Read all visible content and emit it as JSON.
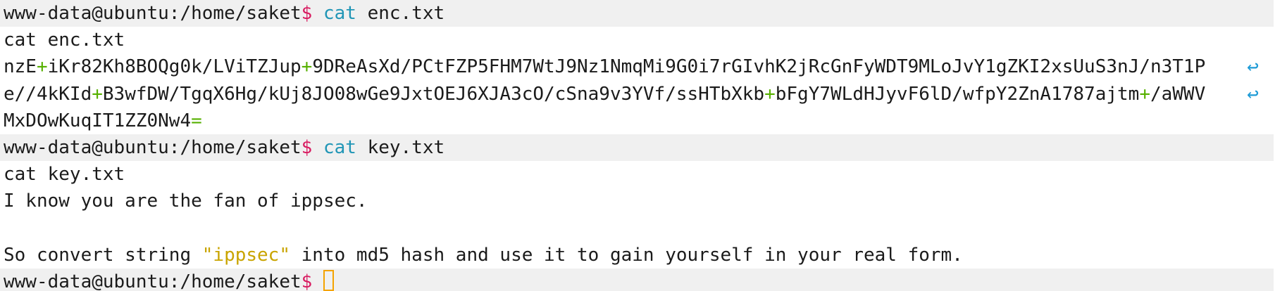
{
  "terminal": {
    "lines": [
      {
        "type": "prompt",
        "user_host_path": "www-data@ubuntu:/home/saket",
        "sign": "$",
        "command": "cat",
        "args": " enc.txt"
      },
      {
        "type": "output",
        "text": "cat enc.txt"
      },
      {
        "type": "encoded",
        "segments": [
          "nzE",
          "+",
          "iKr82Kh8BOQg0k/LViTZJup",
          "+",
          "9DReAsXd/PCtFZP5FHM7WtJ9Nz1NmqMi9G0i7rGIvhK2jRcGnFyWDT9MLoJvY1gZKI2xsUuS3nJ/n3T1P"
        ],
        "wrap_icon": "wrap-arrow-icon"
      },
      {
        "type": "encoded",
        "segments": [
          "e//4kKId",
          "+",
          "B3wfDW/TgqX6Hg/kUj8JO08wGe9JxtOEJ6XJA3cO/cSna9v3YVf/ssHTbXkb",
          "+",
          "bFgY7WLdHJyvF6lD/wfpY2ZnA1787ajtm",
          "+",
          "/aWWV"
        ],
        "wrap_icon": "wrap-arrow-icon"
      },
      {
        "type": "encoded",
        "segments": [
          "MxDOwKuqIT1ZZ0Nw4",
          "="
        ]
      },
      {
        "type": "prompt",
        "user_host_path": "www-data@ubuntu:/home/saket",
        "sign": "$",
        "command": "cat",
        "args": " key.txt"
      },
      {
        "type": "output",
        "text": "cat key.txt"
      },
      {
        "type": "output",
        "text": "I know you are the fan of ippsec."
      },
      {
        "type": "output",
        "text": ""
      },
      {
        "type": "hint",
        "before": "So convert string ",
        "quoted": "\"ippsec\"",
        "after": " into md5 hash and use it to gain yourself in your real form."
      },
      {
        "type": "prompt_active",
        "user_host_path": "www-data@ubuntu:/home/saket",
        "sign": "$",
        "spacer": " "
      }
    ]
  },
  "colors": {
    "prompt_sign": "#d81b60",
    "command": "#2196b6",
    "plus": "#56b000",
    "string": "#c9a400",
    "cursor": "#f4a300",
    "wrap_icon": "#1e9bd6"
  }
}
